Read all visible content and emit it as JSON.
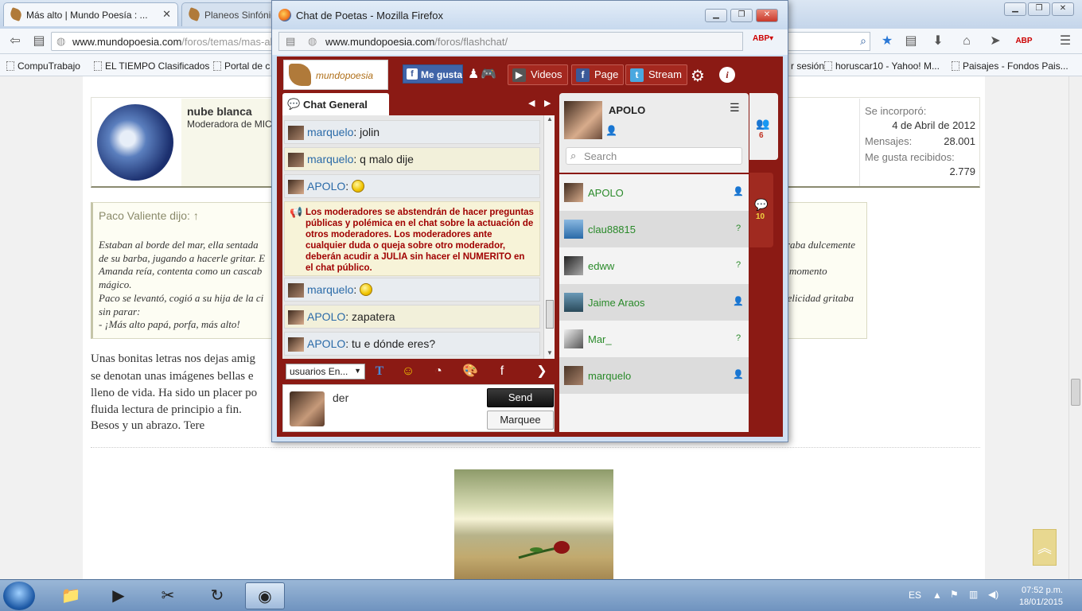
{
  "browser": {
    "tab1_title": "Más alto | Mundo Poesía : ...",
    "tab2_title": "Planeos Sinfónic",
    "url_domain": "www.mundopoesia.com",
    "url_path": "/foros/temas/mas-alto",
    "bookmarks": [
      "CompuTrabajo",
      "EL TIEMPO Clasificados",
      "Portal de c",
      "r sesión",
      "horuscar10 - Yahoo! M...",
      "Paisajes - Fondos Pais..."
    ]
  },
  "post": {
    "poster_name": "nube blanca",
    "poster_role": "Moderadora de MIC",
    "stats": [
      {
        "label": "Se incorporó:",
        "value": "4 de Abril de 2012"
      },
      {
        "label": "Mensajes:",
        "value": "28.001"
      },
      {
        "label": "Me gusta recibidos:",
        "value": "2.779"
      }
    ],
    "quote_header": "Paco Valiente dijo: ↑",
    "quote_lines_left": [
      "Estaban al borde del mar, ella sentada",
      "de su barba, jugando a hacerle gritar. E",
      "Amanda reía, contenta como un cascab",
      "mágico.",
      "Paco se levantó, cogió a su hija de la ci",
      "sin parar:",
      "- ¡Más alto papá, porfa, más alto!"
    ],
    "quote_lines_right": [
      "raba dulcemente",
      "momento",
      "felicidad gritaba"
    ],
    "body_lines": [
      "Unas bonitas letras nos dejas amig",
      "se denotan unas imágenes bellas e",
      "lleno de vida. Ha sido un placer po",
      "fluida lectura de principio a fin.",
      "Besos y un abrazo. Tere"
    ],
    "scroll_top_icon": "double-chevron-up-icon"
  },
  "popup": {
    "title": "Chat de Poetas - Mozilla Firefox",
    "url_domain": "www.mundopoesia.com",
    "url_path": "/foros/flashchat/",
    "logo_text": "mundopoesia",
    "like_label": "Me gusta",
    "header_buttons": [
      "Videos",
      "Page",
      "Stream"
    ],
    "chat_tab": "Chat General",
    "messages": [
      {
        "user": "marquelo",
        "text": "jolin"
      },
      {
        "user": "marquelo",
        "text": "q malo dije"
      },
      {
        "user": "APOLO",
        "text": ""
      },
      {
        "user": "marquelo",
        "text": ""
      },
      {
        "user": "APOLO",
        "text": "zapatera"
      },
      {
        "user": "APOLO",
        "text": "tu e dónde eres?"
      }
    ],
    "notice": "Los moderadores se abstendrán de hacer preguntas públicas y polémica en el chat sobre la actuación de otros moderadores. Los moderadores ante cualquier duda o queja sobre otro moderador, deberán acudir a JULIA sin hacer el NUMERITO en el chat público.",
    "user_select": "usuarios En...",
    "input_text": "der",
    "send_label": "Send",
    "marquee_label": "Marquee",
    "me_name": "APOLO",
    "search_placeholder": "Search",
    "users": [
      "APOLO",
      "clau88815",
      "edww",
      "Jaime Araos",
      "Mar_",
      "marquelo"
    ],
    "side_counts": [
      "6",
      "10"
    ]
  },
  "taskbar": {
    "lang": "ES",
    "time": "07:52 p.m.",
    "date": "18/01/2015"
  }
}
